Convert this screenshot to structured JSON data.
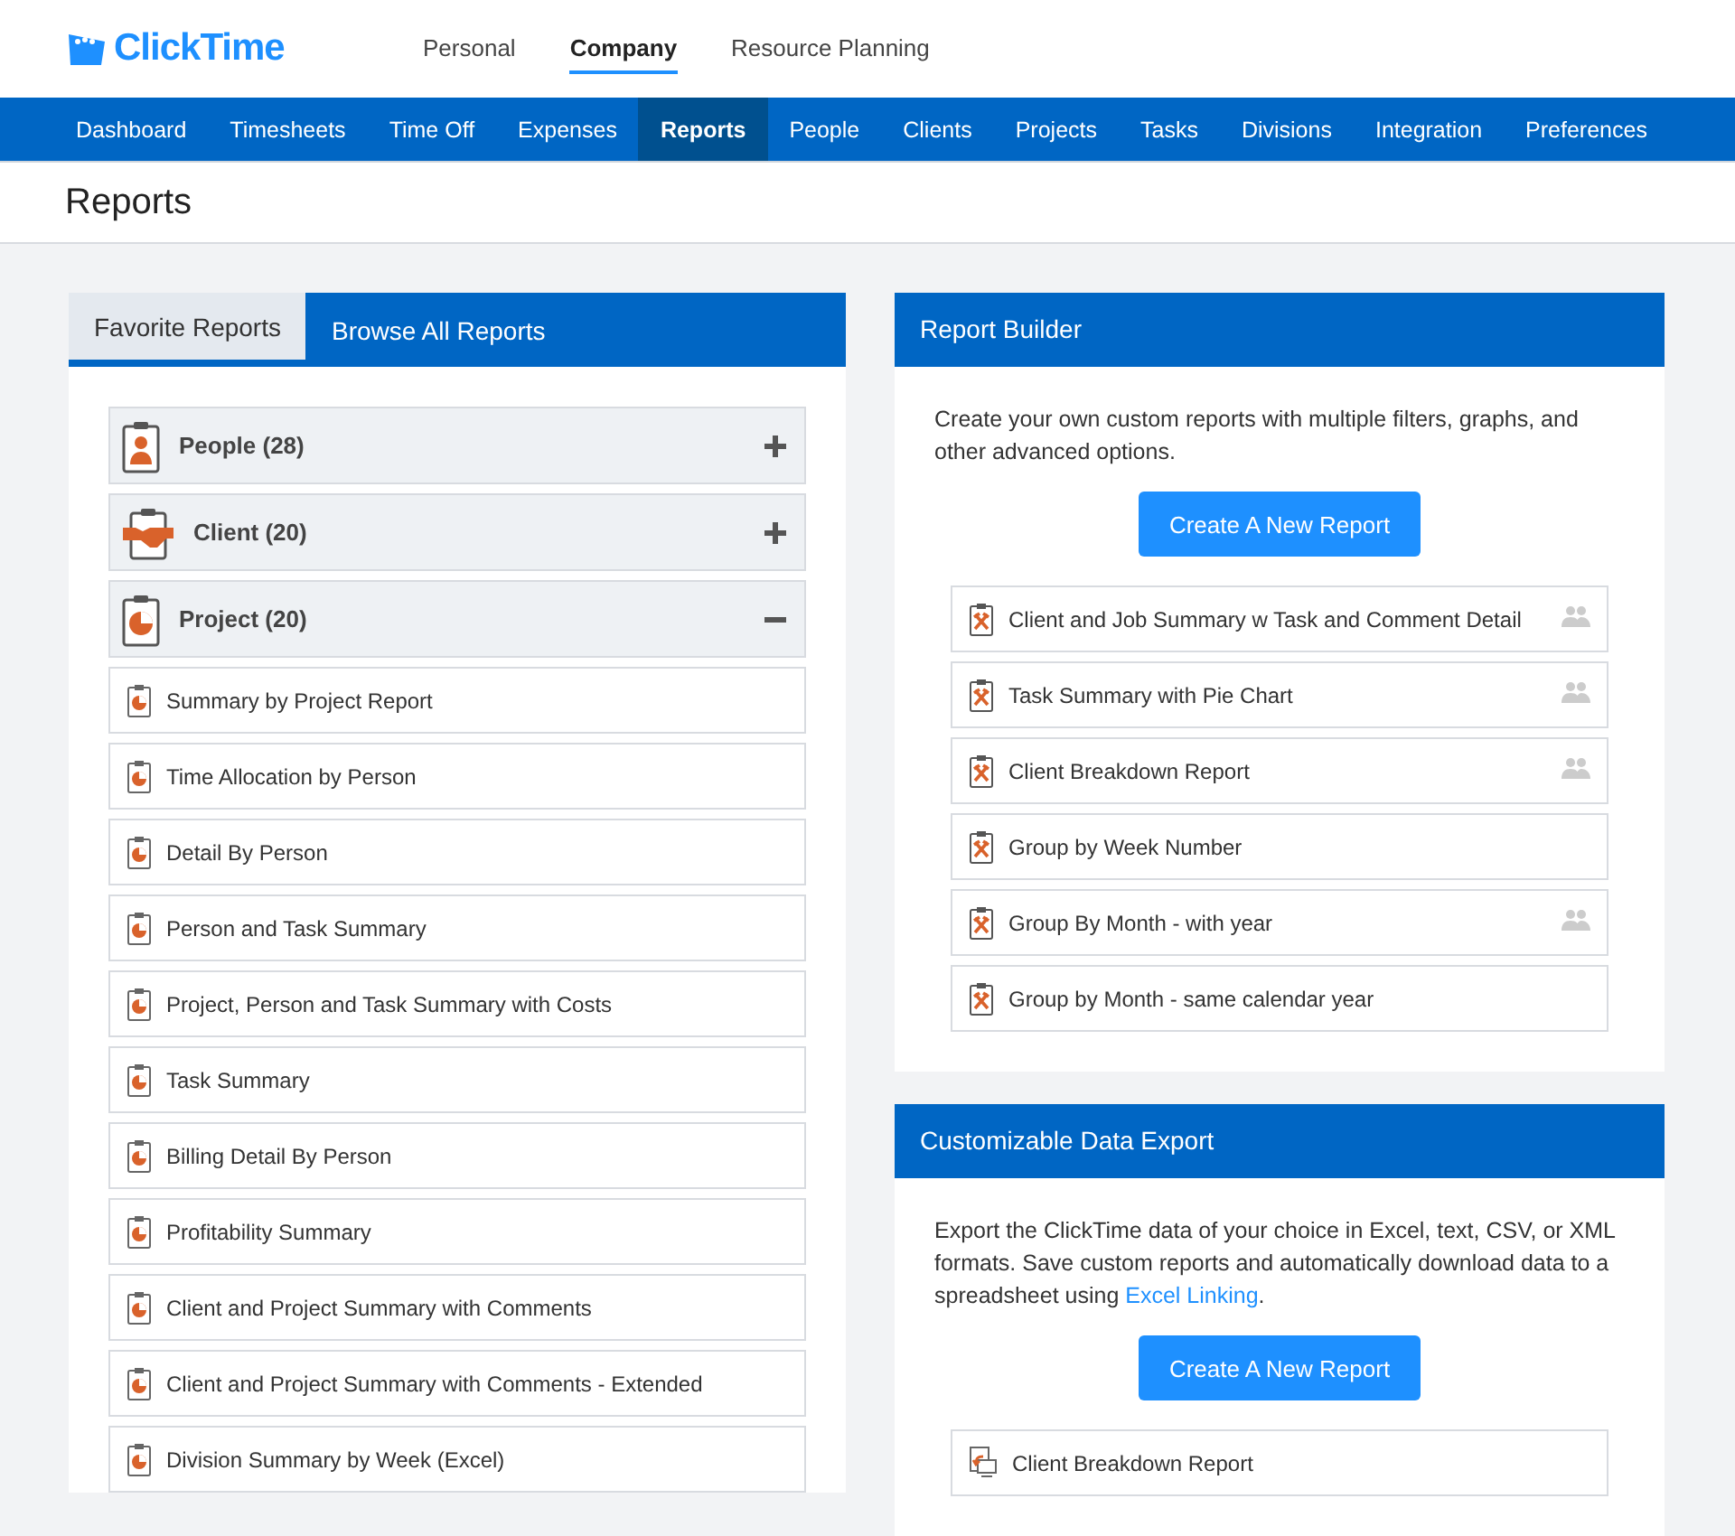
{
  "brand": {
    "name": "ClickTime"
  },
  "top_tabs": [
    {
      "label": "Personal",
      "selected": false
    },
    {
      "label": "Company",
      "selected": true
    },
    {
      "label": "Resource Planning",
      "selected": false
    }
  ],
  "nav": [
    {
      "label": "Dashboard",
      "selected": false
    },
    {
      "label": "Timesheets",
      "selected": false
    },
    {
      "label": "Time Off",
      "selected": false
    },
    {
      "label": "Expenses",
      "selected": false
    },
    {
      "label": "Reports",
      "selected": true
    },
    {
      "label": "People",
      "selected": false
    },
    {
      "label": "Clients",
      "selected": false
    },
    {
      "label": "Projects",
      "selected": false
    },
    {
      "label": "Tasks",
      "selected": false
    },
    {
      "label": "Divisions",
      "selected": false
    },
    {
      "label": "Integration",
      "selected": false
    },
    {
      "label": "Preferences",
      "selected": false
    }
  ],
  "page_title": "Reports",
  "report_tabs": [
    {
      "label": "Favorite Reports",
      "selected": false
    },
    {
      "label": "Browse All Reports",
      "selected": true
    }
  ],
  "categories": [
    {
      "kind": "person",
      "label": "People (28)",
      "expanded": false
    },
    {
      "kind": "handshake",
      "label": "Client (20)",
      "expanded": false
    },
    {
      "kind": "pie",
      "label": "Project (20)",
      "expanded": true,
      "reports": [
        "Summary by Project Report",
        "Time Allocation by Person",
        "Detail By Person",
        "Person and Task Summary",
        "Project, Person and Task Summary with Costs",
        "Task Summary",
        "Billing Detail By Person",
        "Profitability Summary",
        "Client and Project Summary with Comments",
        "Client and Project Summary with Comments - Extended",
        "Division Summary by Week (Excel)"
      ]
    }
  ],
  "report_builder": {
    "title": "Report Builder",
    "description": "Create your own custom reports with multiple filters, graphs, and other advanced options.",
    "button": "Create A New Report",
    "reports": [
      {
        "label": "Client and Job Summary w Task and Comment Detail",
        "shared": true
      },
      {
        "label": "Task Summary with Pie Chart",
        "shared": true
      },
      {
        "label": "Client Breakdown Report",
        "shared": true
      },
      {
        "label": "Group by Week Number",
        "shared": false
      },
      {
        "label": "Group By Month - with year",
        "shared": true
      },
      {
        "label": "Group by Month - same calendar year",
        "shared": false
      }
    ]
  },
  "data_export": {
    "title": "Customizable Data Export",
    "description": "Export the ClickTime data of your choice in Excel, text, CSV, or XML formats. Save custom reports and automatically download data to a spreadsheet using ",
    "link": "Excel Linking",
    "description_end": ".",
    "button": "Create A New Report",
    "reports": [
      {
        "label": "Client Breakdown Report",
        "shared": false
      }
    ]
  }
}
